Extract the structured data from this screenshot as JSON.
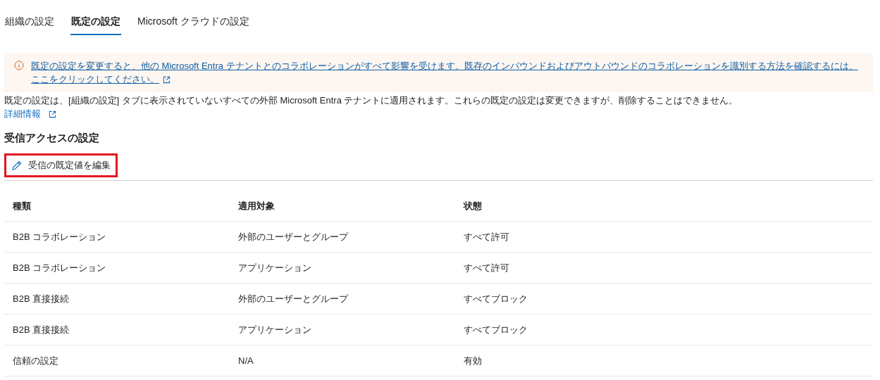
{
  "tabs": [
    {
      "label": "組織の設定",
      "selected": false
    },
    {
      "label": "既定の設定",
      "selected": true
    },
    {
      "label": "Microsoft クラウドの設定",
      "selected": false
    }
  ],
  "banner": {
    "link": "既定の設定を変更すると、他の Microsoft Entra テナントとのコラボレーションがすべて影響を受けます。既存のインバウンドおよびアウトバウンドのコラボレーションを識別する方法を確認するには、ここをクリックしてください。"
  },
  "description": "既定の設定は、[組織の設定] タブに表示されていないすべての外部 Microsoft Entra テナントに適用されます。これらの既定の設定は変更できますが、削除することはできません。",
  "details_link": "詳細情報",
  "section_title": "受信アクセスの設定",
  "edit_button": {
    "label": "受信の既定値を編集",
    "highlighted": true
  },
  "table": {
    "columns": [
      "種類",
      "適用対象",
      "状態"
    ],
    "rows": [
      [
        "B2B コラボレーション",
        "外部のユーザーとグループ",
        "すべて許可"
      ],
      [
        "B2B コラボレーション",
        "アプリケーション",
        "すべて許可"
      ],
      [
        "B2B 直接接続",
        "外部のユーザーとグループ",
        "すべてブロック"
      ],
      [
        "B2B 直接接続",
        "アプリケーション",
        "すべてブロック"
      ],
      [
        "信頼の設定",
        "N/A",
        "有効"
      ]
    ]
  }
}
